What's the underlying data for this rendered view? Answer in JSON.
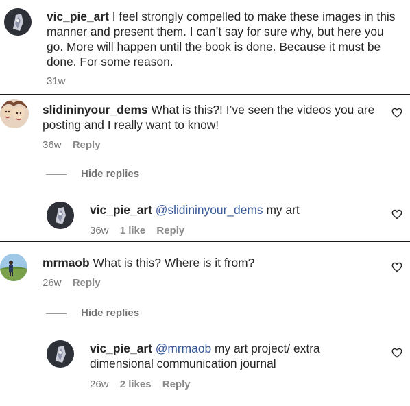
{
  "comments": [
    {
      "username": "vic_pie_art",
      "text": "I feel strongly compelled to make these images in this manner and present them. I can’t say for sure why, but here you go. More will happen until the book is done. Because it must be done. For some reason.",
      "time": "31w"
    },
    {
      "username": "slidininyour_dems",
      "text": "What is this?! I’ve seen the videos you are posting and I really want to know!",
      "time": "36w",
      "reply_label": "Reply",
      "hide_replies_label": "Hide replies",
      "replies": [
        {
          "username": "vic_pie_art",
          "mention": "@slidininyour_dems",
          "text": "my art",
          "time": "36w",
          "likes": "1 like",
          "reply_label": "Reply"
        }
      ]
    },
    {
      "username": "mrmaob",
      "text": "What is this? Where is it from?",
      "time": "26w",
      "reply_label": "Reply",
      "hide_replies_label": "Hide replies",
      "replies": [
        {
          "username": "vic_pie_art",
          "mention": "@mrmaob",
          "text": "my art project/ extra dimensional communication journal",
          "time": "26w",
          "likes": "2 likes",
          "reply_label": "Reply"
        }
      ]
    }
  ],
  "icons": {
    "like": "heart-outline-icon"
  },
  "colors": {
    "username": "#262626",
    "mention": "#385898",
    "meta": "#737373",
    "divider": "#1a1a1a"
  }
}
